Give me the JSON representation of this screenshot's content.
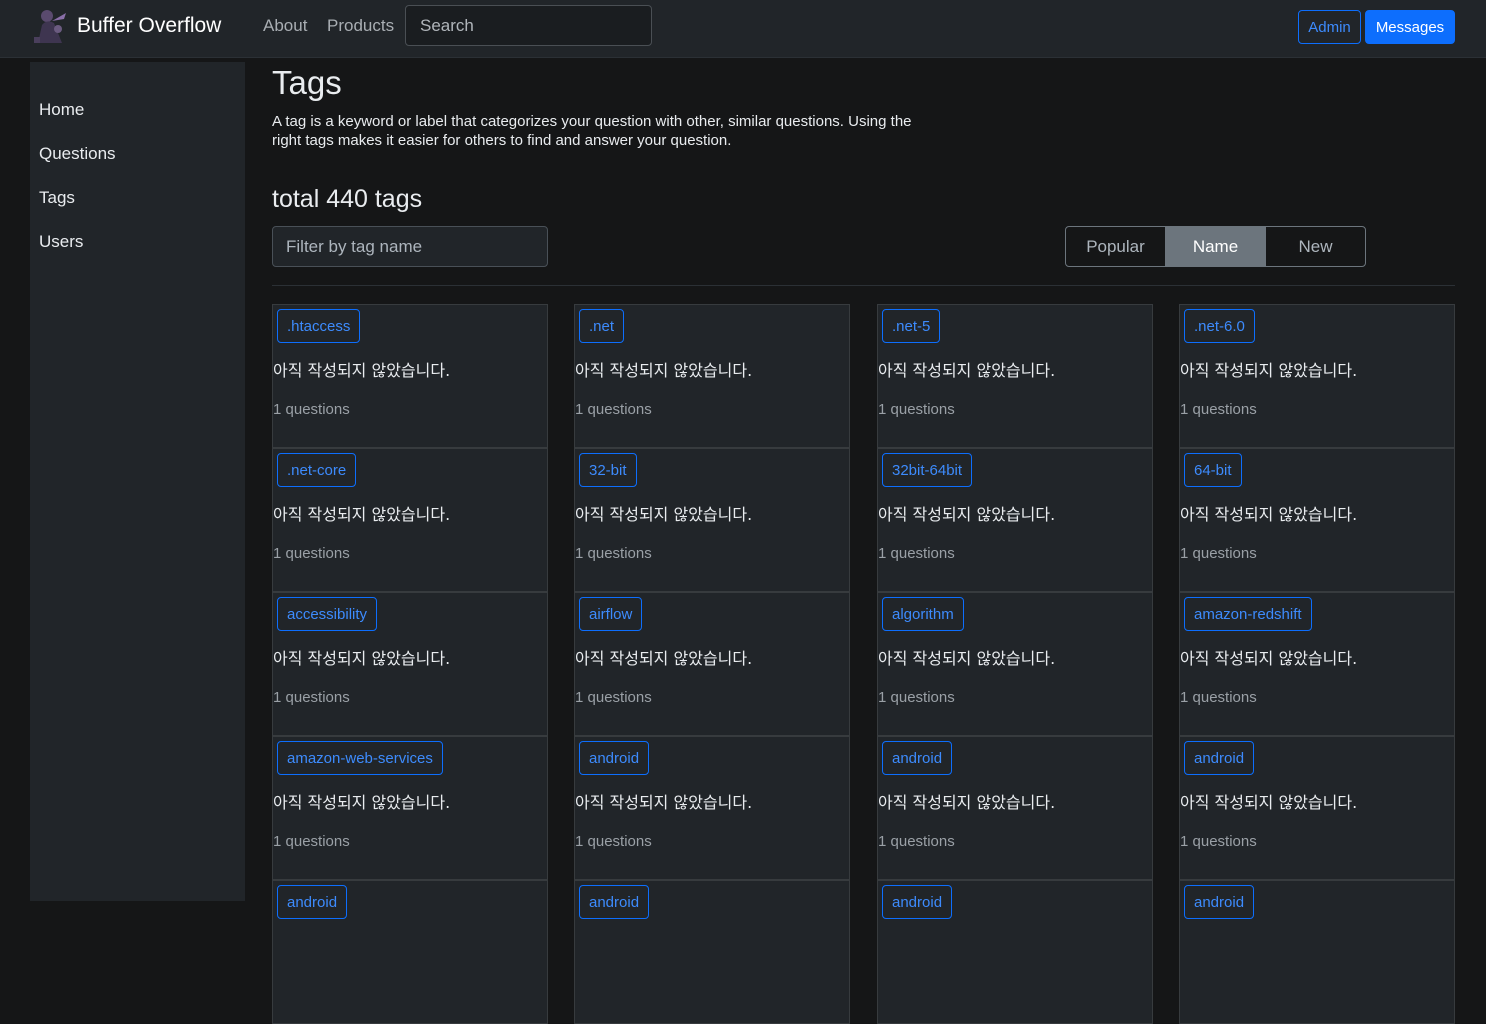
{
  "navbar": {
    "brand": "Buffer Overflow",
    "links": [
      "About",
      "Products"
    ],
    "search_placeholder": "Search",
    "admin_label": "Admin",
    "messages_label": "Messages"
  },
  "sidebar": {
    "items": [
      {
        "label": "Home"
      },
      {
        "label": "Questions"
      },
      {
        "label": "Tags"
      },
      {
        "label": "Users"
      }
    ]
  },
  "main": {
    "title": "Tags",
    "description": "A tag is a keyword or label that categorizes your question with other, similar questions. Using the right tags makes it easier for others to find and answer your question.",
    "total": "total 440 tags",
    "filter_placeholder": "Filter by tag name",
    "sort_options": [
      "Popular",
      "Name",
      "New"
    ],
    "sort_selected": "Name"
  },
  "tags": [
    {
      "name": ".htaccess",
      "desc": "아직 작성되지 않았습니다.",
      "count": "1 questions"
    },
    {
      "name": ".net",
      "desc": "아직 작성되지 않았습니다.",
      "count": "1 questions"
    },
    {
      "name": ".net-5",
      "desc": "아직 작성되지 않았습니다.",
      "count": "1 questions"
    },
    {
      "name": ".net-6.0",
      "desc": "아직 작성되지 않았습니다.",
      "count": "1 questions"
    },
    {
      "name": ".net-core",
      "desc": "아직 작성되지 않았습니다.",
      "count": "1 questions"
    },
    {
      "name": "32-bit",
      "desc": "아직 작성되지 않았습니다.",
      "count": "1 questions"
    },
    {
      "name": "32bit-64bit",
      "desc": "아직 작성되지 않았습니다.",
      "count": "1 questions"
    },
    {
      "name": "64-bit",
      "desc": "아직 작성되지 않았습니다.",
      "count": "1 questions"
    },
    {
      "name": "accessibility",
      "desc": "아직 작성되지 않았습니다.",
      "count": "1 questions"
    },
    {
      "name": "airflow",
      "desc": "아직 작성되지 않았습니다.",
      "count": "1 questions"
    },
    {
      "name": "algorithm",
      "desc": "아직 작성되지 않았습니다.",
      "count": "1 questions"
    },
    {
      "name": "amazon-redshift",
      "desc": "아직 작성되지 않았습니다.",
      "count": "1 questions"
    },
    {
      "name": "amazon-web-services",
      "desc": "아직 작성되지 않았습니다.",
      "count": "1 questions"
    },
    {
      "name": "android",
      "desc": "아직 작성되지 않았습니다.",
      "count": "1 questions"
    },
    {
      "name": "android",
      "desc": "아직 작성되지 않았습니다.",
      "count": "1 questions"
    },
    {
      "name": "android",
      "desc": "아직 작성되지 않았습니다.",
      "count": "1 questions"
    },
    {
      "name": "android",
      "desc": "",
      "count": ""
    },
    {
      "name": "android",
      "desc": "",
      "count": ""
    },
    {
      "name": "android",
      "desc": "",
      "count": ""
    },
    {
      "name": "android",
      "desc": "",
      "count": ""
    }
  ]
}
